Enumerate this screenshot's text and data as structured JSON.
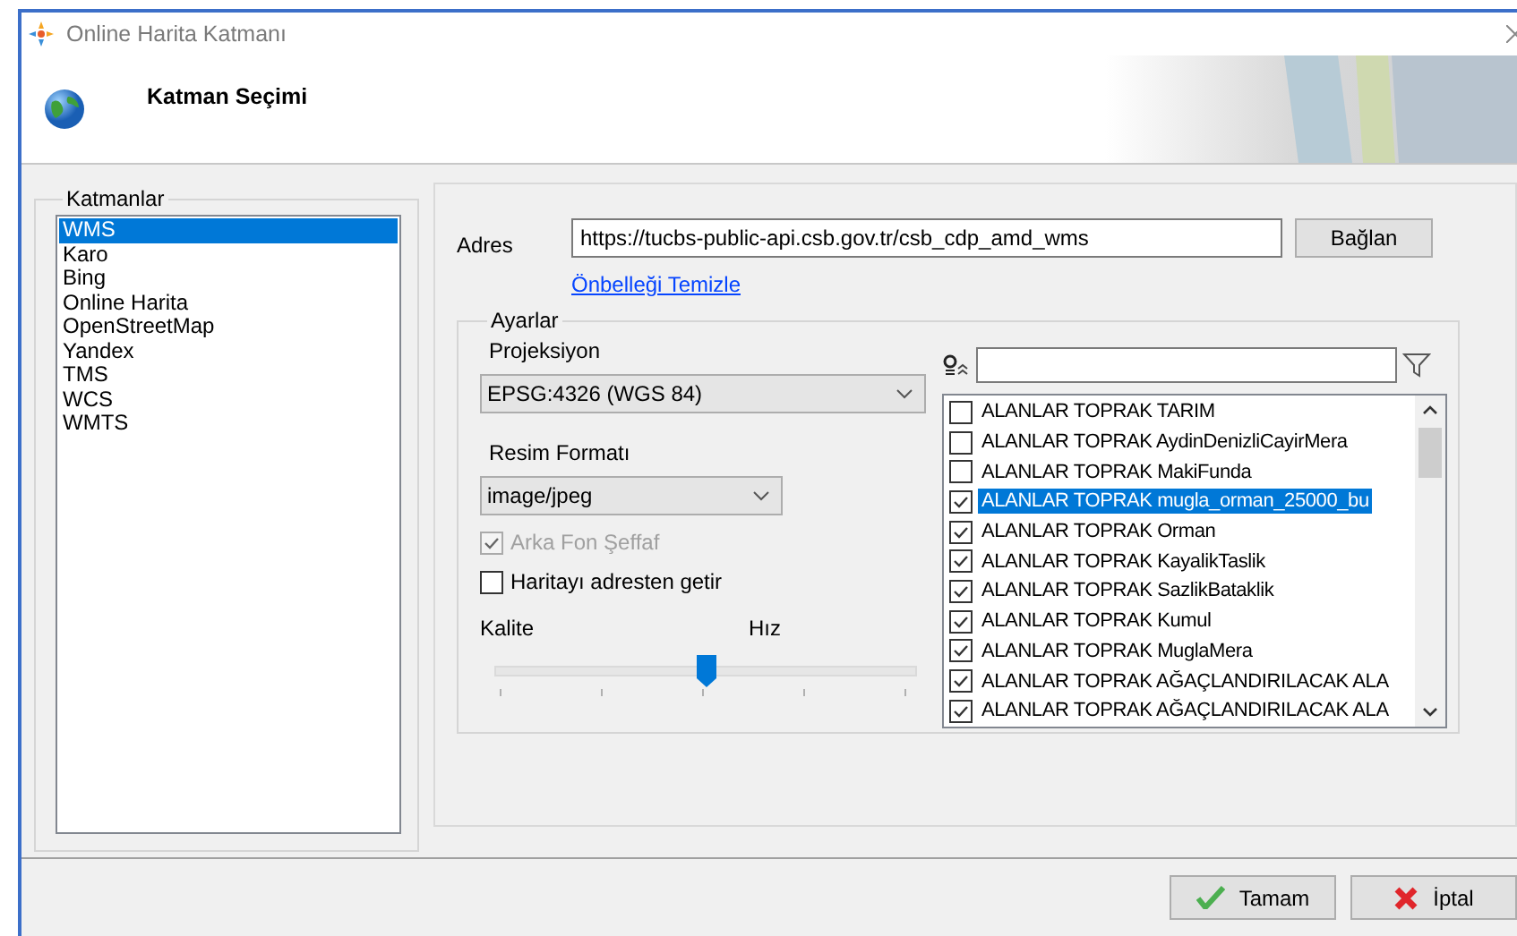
{
  "window": {
    "title": "Online Harita Katmanı"
  },
  "header": {
    "title": "Katman Seçimi"
  },
  "layers_group": {
    "title": "Katmanlar",
    "items": [
      {
        "label": "WMS",
        "selected": true
      },
      {
        "label": "Karo",
        "selected": false
      },
      {
        "label": "Bing",
        "selected": false
      },
      {
        "label": "Online Harita",
        "selected": false
      },
      {
        "label": "OpenStreetMap",
        "selected": false
      },
      {
        "label": "Yandex",
        "selected": false
      },
      {
        "label": "TMS",
        "selected": false
      },
      {
        "label": "WCS",
        "selected": false
      },
      {
        "label": "WMTS",
        "selected": false
      }
    ]
  },
  "address": {
    "label": "Adres",
    "value": "https://tucbs-public-api.csb.gov.tr/csb_cdp_amd_wms",
    "connect_button": "Bağlan",
    "clear_cache_link": "Önbelleği Temizle"
  },
  "settings": {
    "title": "Ayarlar",
    "projection_label": "Projeksiyon",
    "projection_value": "EPSG:4326 (WGS 84)",
    "format_label": "Resim Formatı",
    "format_value": "image/jpeg",
    "options": [
      {
        "label": "Arka Fon Şeffaf",
        "checked": true,
        "disabled": true
      },
      {
        "label": "Haritayı adresten getir",
        "checked": false,
        "disabled": false
      }
    ],
    "quality_label": "Kalite",
    "speed_label": "Hız",
    "slider": {
      "level": 0.5
    }
  },
  "layer_list": {
    "items": [
      {
        "label": "ALANLAR TOPRAK TARIM",
        "checked": false,
        "selected": false
      },
      {
        "label": "ALANLAR TOPRAK AydinDenizliCayirMera",
        "checked": false,
        "selected": false
      },
      {
        "label": "ALANLAR TOPRAK MakiFunda",
        "checked": false,
        "selected": false
      },
      {
        "label": "ALANLAR TOPRAK mugla_orman_25000_bu",
        "checked": true,
        "selected": true
      },
      {
        "label": "ALANLAR TOPRAK Orman",
        "checked": true,
        "selected": false
      },
      {
        "label": "ALANLAR TOPRAK KayalikTaslik",
        "checked": true,
        "selected": false
      },
      {
        "label": "ALANLAR TOPRAK SazlikBataklik",
        "checked": true,
        "selected": false
      },
      {
        "label": "ALANLAR TOPRAK Kumul",
        "checked": true,
        "selected": false
      },
      {
        "label": "ALANLAR TOPRAK MuglaMera",
        "checked": true,
        "selected": false
      },
      {
        "label": "ALANLAR TOPRAK AĞAÇLANDIRILACAK ALA",
        "checked": true,
        "selected": false
      },
      {
        "label": "ALANLAR TOPRAK AĞAÇLANDIRILACAK ALA",
        "checked": true,
        "selected": false
      }
    ]
  },
  "buttons": [
    {
      "kind": "ok",
      "label": "Tamam"
    },
    {
      "kind": "cancel",
      "label": "İptal"
    }
  ]
}
